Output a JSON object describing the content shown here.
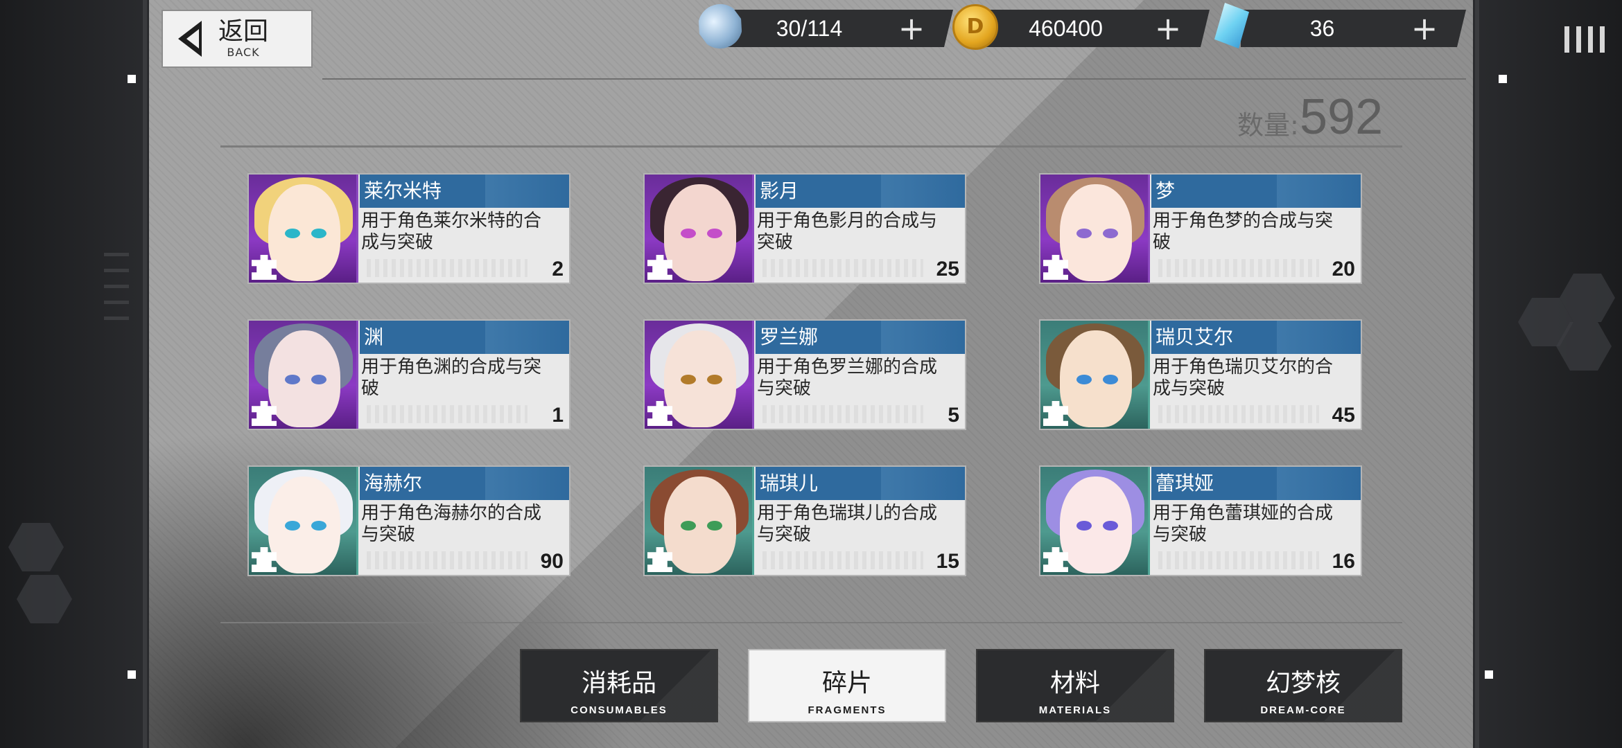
{
  "header": {
    "back_cn": "返回",
    "back_en": "BACK",
    "resources": [
      {
        "icon": "stamina-icon",
        "value": "30/114"
      },
      {
        "icon": "gold-coin-icon",
        "value": "460400"
      },
      {
        "icon": "diamond-icon",
        "value": "36"
      }
    ],
    "plus_label": "+"
  },
  "inventory": {
    "count_label": "数量:",
    "count_value": "592"
  },
  "fragments": [
    {
      "name": "莱尔米特",
      "desc": "用于角色莱尔米特的合成与突破",
      "qty": "2",
      "rarity": "purple",
      "hair": "#f1d27b",
      "skin": "#fbe7d6",
      "eye": "#2bb6c9"
    },
    {
      "name": "影月",
      "desc": "用于角色影月的合成与突破",
      "qty": "25",
      "rarity": "purple",
      "hair": "#3a2532",
      "skin": "#f3d6cf",
      "eye": "#c44ec9"
    },
    {
      "name": "梦",
      "desc": "用于角色梦的合成与突破",
      "qty": "20",
      "rarity": "purple",
      "hair": "#b98c6f",
      "skin": "#fbe6dc",
      "eye": "#8d6ad0"
    },
    {
      "name": "渊",
      "desc": "用于角色渊的合成与突破",
      "qty": "1",
      "rarity": "purple",
      "hair": "#767e9c",
      "skin": "#f3e1e1",
      "eye": "#5f78c9"
    },
    {
      "name": "罗兰娜",
      "desc": "用于角色罗兰娜的合成与突破",
      "qty": "5",
      "rarity": "purple",
      "hair": "#e6e6ea",
      "skin": "#f6e2d8",
      "eye": "#b27b2a"
    },
    {
      "name": "瑞贝艾尔",
      "desc": "用于角色瑞贝艾尔的合成与突破",
      "qty": "45",
      "rarity": "teal",
      "hair": "#7a5a3b",
      "skin": "#f6e0cc",
      "eye": "#3c8bd6"
    },
    {
      "name": "海赫尔",
      "desc": "用于角色海赫尔的合成与突破",
      "qty": "90",
      "rarity": "teal",
      "hair": "#eef0f6",
      "skin": "#fbeee8",
      "eye": "#3aa7d8"
    },
    {
      "name": "瑞琪儿",
      "desc": "用于角色瑞琪儿的合成与突破",
      "qty": "15",
      "rarity": "teal",
      "hair": "#8a4b32",
      "skin": "#f4dccd",
      "eye": "#3e9c58"
    },
    {
      "name": "蕾琪娅",
      "desc": "用于角色蕾琪娅的合成与突破",
      "qty": "16",
      "rarity": "teal",
      "hair": "#9d8ee3",
      "skin": "#fbe8e8",
      "eye": "#6a5bd8"
    }
  ],
  "tabs": [
    {
      "cn": "消耗品",
      "en": "CONSUMABLES",
      "active": false
    },
    {
      "cn": "碎片",
      "en": "FRAGMENTS",
      "active": true
    },
    {
      "cn": "材料",
      "en": "MATERIALS",
      "active": false
    },
    {
      "cn": "幻梦核",
      "en": "DREAM-CORE",
      "active": false
    }
  ]
}
